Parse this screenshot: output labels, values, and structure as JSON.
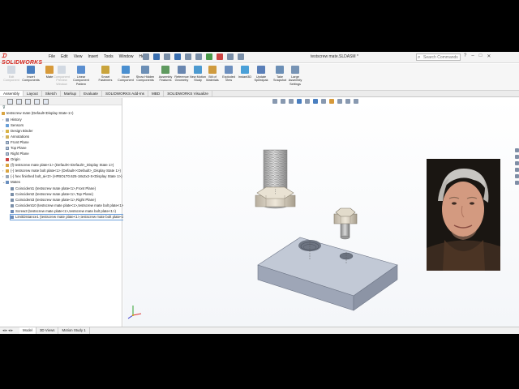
{
  "app": {
    "logo": "SOLIDWORKS",
    "document_title": "testscrew mate.SLDASM *",
    "search_placeholder": "Search Commands"
  },
  "menu": [
    "File",
    "Edit",
    "View",
    "Insert",
    "Tools",
    "Window",
    "Help"
  ],
  "command_manager": [
    {
      "label": "Edit Component",
      "icon": "edit-component-icon",
      "disabled": true
    },
    {
      "label": "Insert Components",
      "icon": "insert-components-icon",
      "disabled": false
    },
    {
      "label": "Mate",
      "icon": "mate-icon",
      "disabled": false
    },
    {
      "label": "Component Preview Window",
      "icon": "component-preview-icon",
      "disabled": true
    },
    {
      "label": "Linear Component Pattern",
      "icon": "linear-pattern-icon",
      "disabled": false
    },
    {
      "label": "Smart Fasteners",
      "icon": "smart-fasteners-icon",
      "disabled": false
    },
    {
      "label": "Move Component",
      "icon": "move-component-icon",
      "disabled": false
    },
    {
      "label": "Show Hidden Components",
      "icon": "show-hidden-icon",
      "disabled": false
    },
    {
      "label": "Assembly Features",
      "icon": "assembly-features-icon",
      "disabled": false
    },
    {
      "label": "Reference Geometry",
      "icon": "reference-geometry-icon",
      "disabled": false
    },
    {
      "label": "New Motion Study",
      "icon": "motion-study-icon",
      "disabled": false
    },
    {
      "label": "Bill of Materials",
      "icon": "bom-icon",
      "disabled": false
    },
    {
      "label": "Exploded View",
      "icon": "exploded-view-icon",
      "disabled": false
    },
    {
      "label": "Instant3D",
      "icon": "instant3d-icon",
      "disabled": false
    },
    {
      "label": "Update Speedpak",
      "icon": "speedpak-icon",
      "disabled": false
    },
    {
      "label": "Take Snapshot",
      "icon": "snapshot-icon",
      "disabled": false
    },
    {
      "label": "Large Assembly Settings",
      "icon": "large-assembly-icon",
      "disabled": false
    }
  ],
  "tabs": [
    "Assembly",
    "Layout",
    "Sketch",
    "Markup",
    "Evaluate",
    "SOLIDWORKS Add-Ins",
    "MBD",
    "SOLIDWORKS Visualize"
  ],
  "tree": {
    "root": "testscrew mate (Default<Display State-1>)",
    "items": [
      "History",
      "Sensors",
      "Design Binder",
      "Annotations",
      "Front Plane",
      "Top Plane",
      "Right Plane",
      "Origin",
      "(f) testscrew mate plate<1> (Default<<Default>_Display State 1>)",
      "(-) testscrew mate bolt plate<1> (Default<<Default>_Display State 1>)",
      "(-) hex finished bolt_ai<2> (HFBOLT0.625-18x2x2-S<Display State 1>)",
      "Mates",
      "Coincident1 (testscrew mate plate<1>,Front Plane)",
      "Coincident2 (testscrew mate plate<1>,Top Plane)",
      "Coincident3 (testscrew mate plate<1>,Right Plane)",
      "Coincident10 (testscrew mate plate<1>,testscrew mate bolt plate<1>)",
      "Screw3 (testscrew mate plate<1>,testscrew mate bolt plate<1>)",
      "LimitDistance1 (testscrew mate plate<1>,testscrew mate bolt plate<1>)"
    ]
  },
  "bottom_tabs": [
    "Model",
    "3D Views",
    "Motion Study 1"
  ],
  "colors": {
    "accent": "#d6241c",
    "selection": "#6b9fdc",
    "plate": "#a9b1c2",
    "bolt": "#c7c7c7",
    "bolt_head": "#ddd5c6"
  }
}
